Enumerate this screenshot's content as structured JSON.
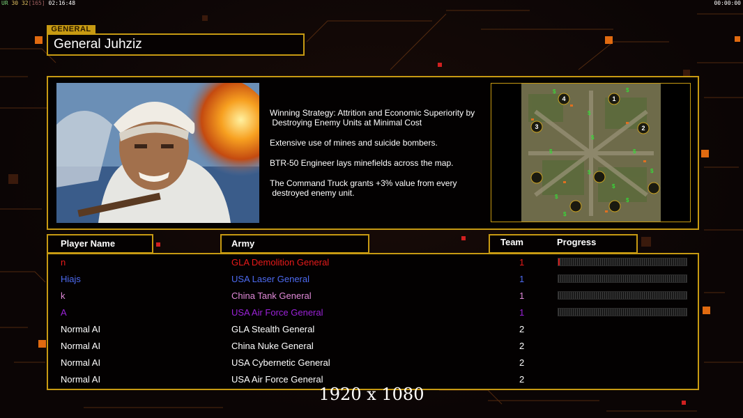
{
  "hud": {
    "fps_label": "UR",
    "fps": "30",
    "frame": "32",
    "frame_total": "[165]",
    "clock": "02:16:48",
    "timer": "00:00:00"
  },
  "colors": {
    "accent": "#c79a12",
    "red": "#e81a1a",
    "blue": "#4d6af0",
    "pink": "#e08ad8",
    "purple": "#9b22d8",
    "white": "#ffffff"
  },
  "general": {
    "section_label": "GENERAL",
    "name": "General Juhziz",
    "description": [
      "Winning Strategy: Attrition and Economic Superiority by\n Destroying Enemy Units at Minimal Cost",
      "Extensive use of mines and suicide bombers.",
      "BTR-50 Engineer lays minefields across the map.",
      "The Command Truck grants +3% value from every\n destroyed enemy unit."
    ]
  },
  "minimap": {
    "start_positions": [
      "4",
      "1",
      "3",
      "2"
    ]
  },
  "table": {
    "headers": {
      "player": "Player Name",
      "army": "Army",
      "team": "Team",
      "progress": "Progress"
    },
    "rows": [
      {
        "name": "n",
        "army": "GLA Demolition General",
        "team": "1",
        "color": "#e81a1a",
        "progress": 0.01
      },
      {
        "name": "Hiajs",
        "army": "USA Laser General",
        "team": "1",
        "color": "#4d6af0",
        "progress": 0
      },
      {
        "name": "k",
        "army": "China Tank General",
        "team": "1",
        "color": "#e08ad8",
        "progress": 0
      },
      {
        "name": "A",
        "army": "USA Air Force General",
        "team": "1",
        "color": "#9b22d8",
        "progress": 0
      },
      {
        "name": "Normal AI",
        "army": "GLA Stealth General",
        "team": "2",
        "color": "#ffffff",
        "progress": null
      },
      {
        "name": "Normal AI",
        "army": "China Nuke General",
        "team": "2",
        "color": "#ffffff",
        "progress": null
      },
      {
        "name": "Normal AI",
        "army": "USA Cybernetic General",
        "team": "2",
        "color": "#ffffff",
        "progress": null
      },
      {
        "name": "Normal AI",
        "army": "USA Air Force General",
        "team": "2",
        "color": "#ffffff",
        "progress": null
      }
    ]
  },
  "resolution_text": "1920 x 1080"
}
